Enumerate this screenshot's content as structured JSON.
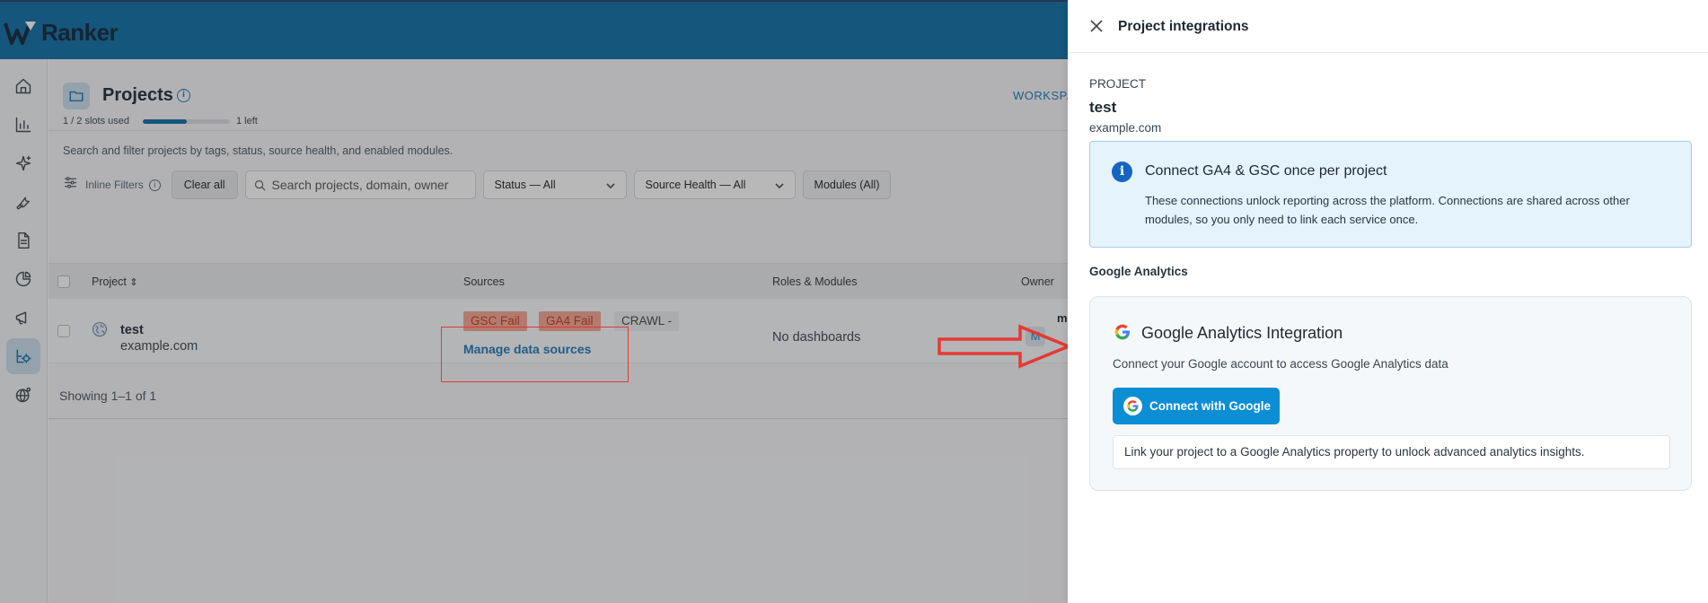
{
  "app": {
    "brand_first": "W",
    "brand_rest": "Ranker"
  },
  "rail": {
    "items": [
      {
        "icon": "home-icon"
      },
      {
        "icon": "bar-chart-icon"
      },
      {
        "icon": "sparkle-icon"
      },
      {
        "icon": "wrench-icon"
      },
      {
        "icon": "document-icon"
      },
      {
        "icon": "pie-chart-icon"
      },
      {
        "icon": "megaphone-icon"
      },
      {
        "icon": "project-settings-icon",
        "active": true
      },
      {
        "icon": "globe-icon"
      }
    ]
  },
  "header": {
    "title": "Projects",
    "slots_text": "1 / 2 slots used",
    "slots_fraction": 0.5,
    "slots_left": "1 left",
    "workspace_link": "WORKSPA",
    "subtitle": "Search and filter projects by tags, status, source health, and enabled modules."
  },
  "filters": {
    "inline_label": "Inline Filters",
    "clear_all": "Clear all",
    "search_placeholder": "Search projects, domain, owner",
    "status": "Status — All",
    "source_health": "Source Health — All",
    "modules": "Modules (All)"
  },
  "table": {
    "columns": {
      "project": "Project",
      "sources": "Sources",
      "roles": "Roles & Modules",
      "owner": "Owner"
    },
    "rows": [
      {
        "name": "test",
        "domain": "example.com",
        "badges": [
          "GSC Fail",
          "GA4 Fail",
          "CRAWL -"
        ],
        "manage": "Manage data sources",
        "roles": "No dashboards",
        "owner_initial": "M",
        "owner_text": "m"
      }
    ],
    "showing": "Showing 1–1 of 1"
  },
  "drawer": {
    "title": "Project integrations",
    "project_label": "PROJECT",
    "project_name": "test",
    "project_domain": "example.com",
    "info": {
      "title": "Connect GA4 & GSC once per project",
      "body": "These connections unlock reporting across the platform. Connections are shared across other modules, so you only need to link each service once."
    },
    "section": "Google Analytics",
    "ga_card": {
      "title": "Google Analytics Integration",
      "description": "Connect your Google account to access Google Analytics data",
      "button": "Connect with Google",
      "note": "Link your project to a Google Analytics property to unlock advanced analytics insights."
    }
  },
  "colors": {
    "brand": "#0b6ea6",
    "accent_button": "#0c8ed4",
    "fail_badge_bg": "#f5a693",
    "fail_badge_text": "#c23b20",
    "annotation": "#e53935"
  }
}
